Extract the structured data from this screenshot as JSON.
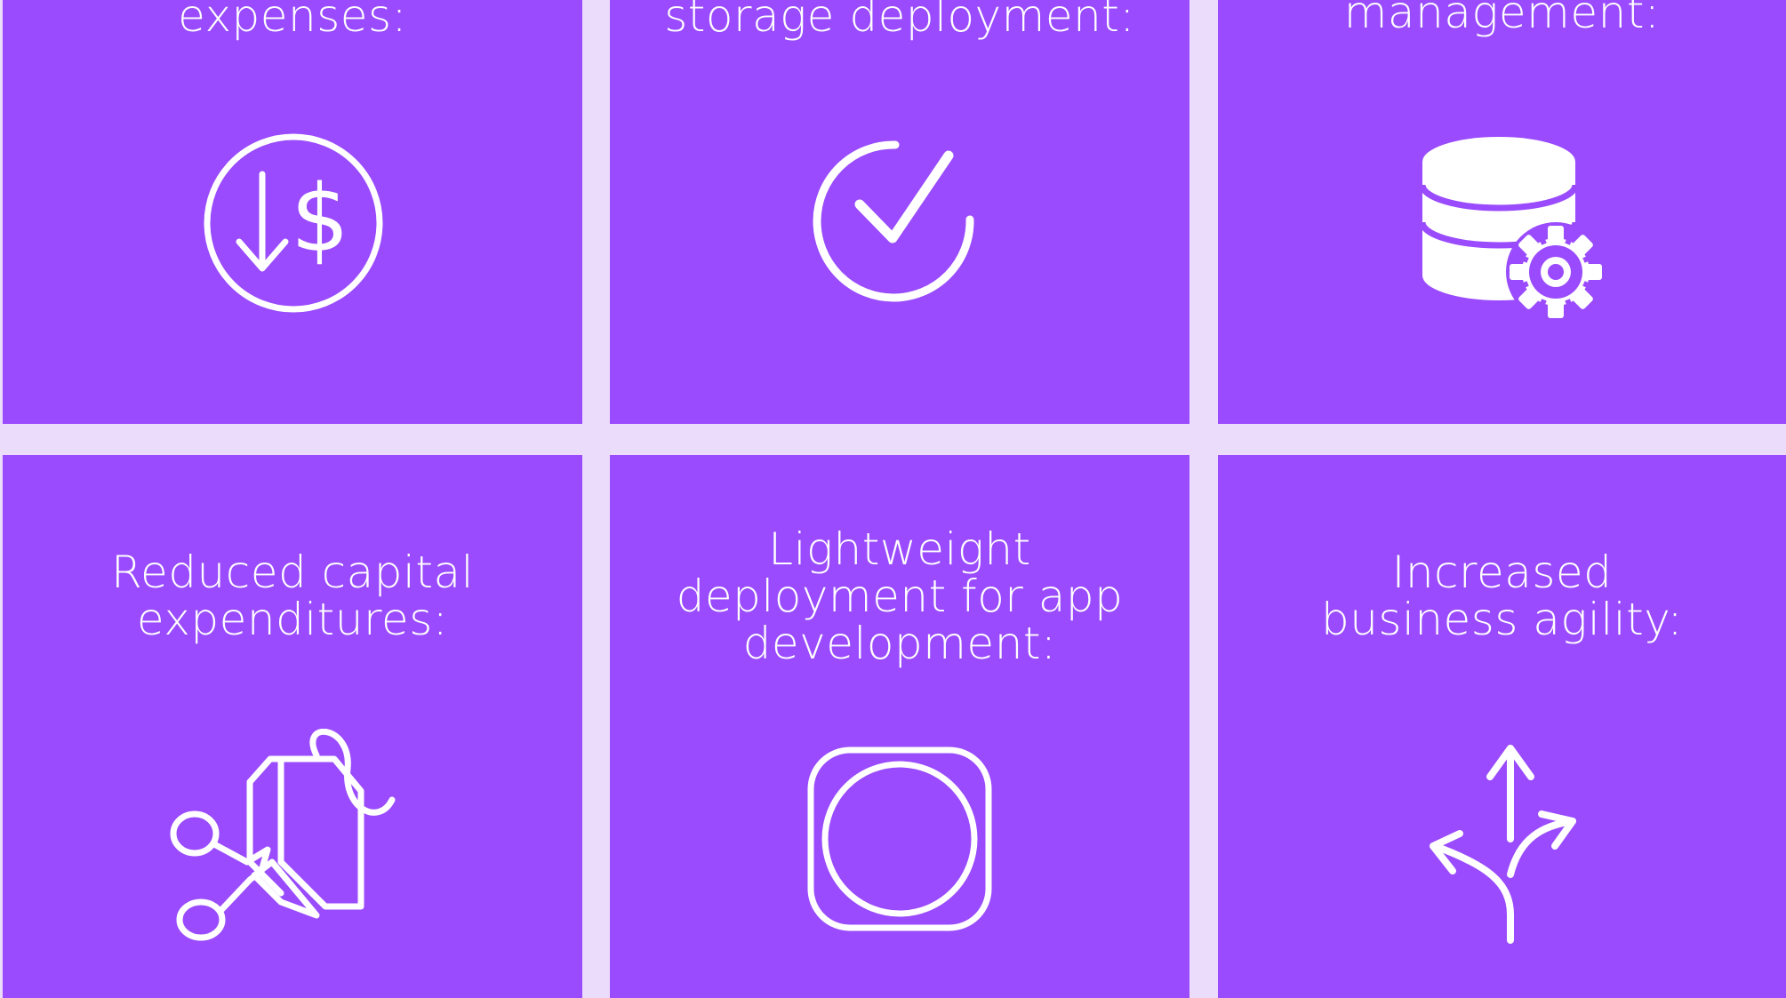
{
  "colors": {
    "background": "#ecdcfb",
    "tile": "#9a4bfd",
    "foreground": "#ffffff"
  },
  "tiles": [
    {
      "title_lines": [
        "expenses:"
      ],
      "icon": "dollar-down-circle-icon"
    },
    {
      "title_lines": [
        "storage deployment:"
      ],
      "icon": "check-circle-icon"
    },
    {
      "title_lines": [
        "management:"
      ],
      "icon": "database-gear-icon"
    },
    {
      "title_lines": [
        "Reduced capital",
        "expenditures:"
      ],
      "icon": "scissors-price-tag-icon"
    },
    {
      "title_lines": [
        "Lightweight",
        "deployment for app",
        "development:"
      ],
      "icon": "rounded-square-circle-icon"
    },
    {
      "title_lines": [
        "Increased",
        "business agility:"
      ],
      "icon": "branching-arrows-icon"
    }
  ]
}
